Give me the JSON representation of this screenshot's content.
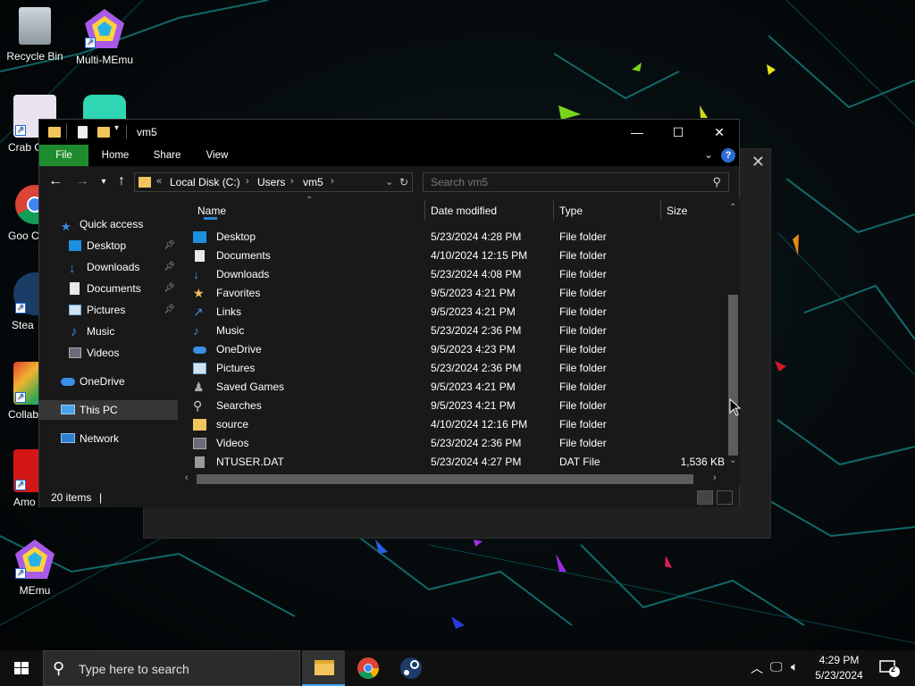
{
  "desktop": {
    "icons": [
      {
        "label": "Recycle Bin"
      },
      {
        "label": "Multi-MEmu"
      },
      {
        "label": "Crab G"
      },
      {
        "label": "Goo Chro"
      },
      {
        "label": "Stea"
      },
      {
        "label": "Collab"
      },
      {
        "label": "Amo"
      },
      {
        "label": "MEmu"
      }
    ]
  },
  "explorer": {
    "title": "vm5",
    "ribbon_tabs": {
      "file": "File",
      "home": "Home",
      "share": "Share",
      "view": "View"
    },
    "help": "?",
    "address": {
      "overflow": "«",
      "crumbs": [
        "Local Disk (C:)",
        "Users",
        "vm5"
      ]
    },
    "search_placeholder": "Search vm5",
    "nav": {
      "quick_access": "Quick access",
      "items": [
        {
          "label": "Desktop",
          "pinned": true
        },
        {
          "label": "Downloads",
          "pinned": true
        },
        {
          "label": "Documents",
          "pinned": true
        },
        {
          "label": "Pictures",
          "pinned": true
        },
        {
          "label": "Music",
          "pinned": false
        },
        {
          "label": "Videos",
          "pinned": false
        }
      ],
      "onedrive": "OneDrive",
      "this_pc": "This PC",
      "network": "Network"
    },
    "columns": {
      "name": "Name",
      "date": "Date modified",
      "type": "Type",
      "size": "Size"
    },
    "rows": [
      {
        "name": "Desktop",
        "date": "5/23/2024 4:28 PM",
        "type": "File folder",
        "size": "",
        "icon": "desktop-folder-icon"
      },
      {
        "name": "Documents",
        "date": "4/10/2024 12:15 PM",
        "type": "File folder",
        "size": "",
        "icon": "documents-folder-icon"
      },
      {
        "name": "Downloads",
        "date": "5/23/2024 4:08 PM",
        "type": "File folder",
        "size": "",
        "icon": "downloads-folder-icon"
      },
      {
        "name": "Favorites",
        "date": "9/5/2023 4:21 PM",
        "type": "File folder",
        "size": "",
        "icon": "favorites-folder-icon"
      },
      {
        "name": "Links",
        "date": "9/5/2023 4:21 PM",
        "type": "File folder",
        "size": "",
        "icon": "links-folder-icon"
      },
      {
        "name": "Music",
        "date": "5/23/2024 2:36 PM",
        "type": "File folder",
        "size": "",
        "icon": "music-folder-icon"
      },
      {
        "name": "OneDrive",
        "date": "9/5/2023 4:23 PM",
        "type": "File folder",
        "size": "",
        "icon": "onedrive-folder-icon"
      },
      {
        "name": "Pictures",
        "date": "5/23/2024 2:36 PM",
        "type": "File folder",
        "size": "",
        "icon": "pictures-folder-icon"
      },
      {
        "name": "Saved Games",
        "date": "9/5/2023 4:21 PM",
        "type": "File folder",
        "size": "",
        "icon": "saved-games-folder-icon"
      },
      {
        "name": "Searches",
        "date": "9/5/2023 4:21 PM",
        "type": "File folder",
        "size": "",
        "icon": "searches-folder-icon"
      },
      {
        "name": "source",
        "date": "4/10/2024 12:16 PM",
        "type": "File folder",
        "size": "",
        "icon": "folder-icon"
      },
      {
        "name": "Videos",
        "date": "5/23/2024 2:36 PM",
        "type": "File folder",
        "size": "",
        "icon": "videos-folder-icon"
      },
      {
        "name": "NTUSER.DAT",
        "date": "5/23/2024 4:27 PM",
        "type": "DAT File",
        "size": "1,536 KB",
        "icon": "file-icon"
      }
    ],
    "status": "20 items"
  },
  "taskbar": {
    "search_placeholder": "Type here to search",
    "time": "4:29 PM",
    "date": "5/23/2024",
    "notification_count": "2"
  },
  "colors": {
    "file_tab": "#1e8c2e",
    "folder": "#f2c55c",
    "accent_blue": "#2b6cd1"
  }
}
